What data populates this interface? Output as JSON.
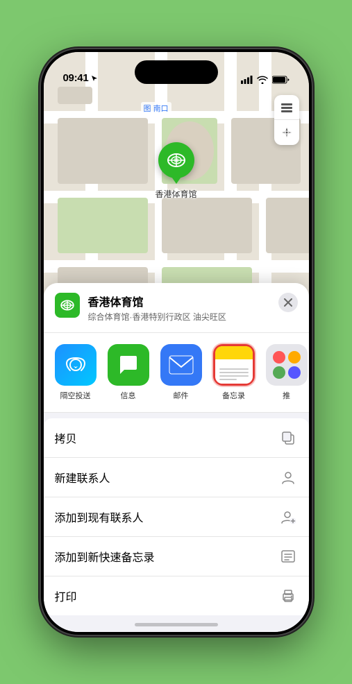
{
  "status": {
    "time": "09:41",
    "location_arrow": true
  },
  "map": {
    "label_nankow": "南口",
    "label_nankow_prefix": "图"
  },
  "pin": {
    "name": "香港体育馆",
    "name_label": "香港体育馆"
  },
  "location_card": {
    "name": "香港体育馆",
    "subtitle": "综合体育馆·香港特别行政区 油尖旺区",
    "close_label": "×"
  },
  "share_items": [
    {
      "id": "airdrop",
      "label": "隔空投送",
      "type": "airdrop"
    },
    {
      "id": "message",
      "label": "信息",
      "type": "message"
    },
    {
      "id": "mail",
      "label": "邮件",
      "type": "mail"
    },
    {
      "id": "notes",
      "label": "备忘录",
      "type": "notes"
    },
    {
      "id": "more",
      "label": "推",
      "type": "more"
    }
  ],
  "menu_items": [
    {
      "id": "copy",
      "label": "拷贝",
      "icon": "copy-icon"
    },
    {
      "id": "new-contact",
      "label": "新建联系人",
      "icon": "new-contact-icon"
    },
    {
      "id": "add-existing",
      "label": "添加到现有联系人",
      "icon": "add-contact-icon"
    },
    {
      "id": "add-note",
      "label": "添加到新快速备忘录",
      "icon": "note-icon"
    },
    {
      "id": "print",
      "label": "打印",
      "icon": "print-icon"
    }
  ]
}
